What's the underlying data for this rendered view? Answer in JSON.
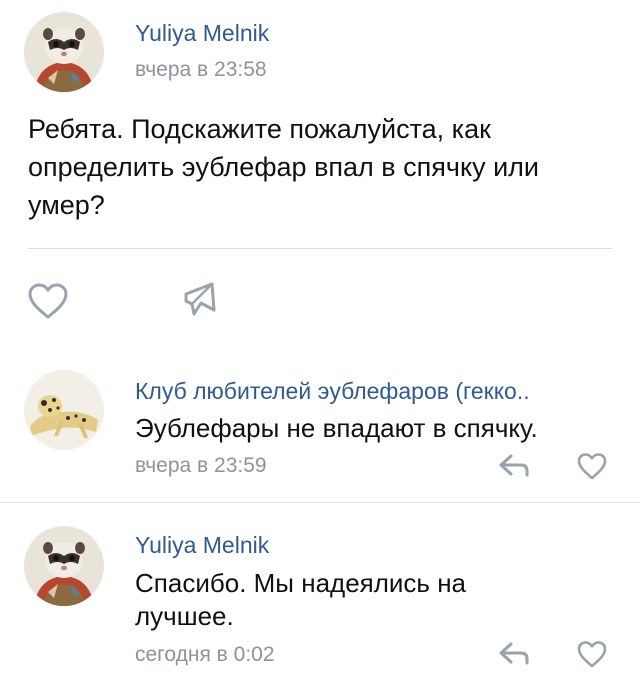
{
  "post": {
    "author": "Yuliya Melnik",
    "time": "вчера в 23:58",
    "text_lines": [
      "Ребята. Подскажите пожалуйста, как",
      "определить эублефар впал в спячку или",
      "умер?"
    ],
    "actions": [
      "heart-icon",
      "share-icon"
    ]
  },
  "comments": [
    {
      "author": "Клуб любителей эублефаров (гекко..",
      "text_lines": [
        "Эублефары не впадают в спячку."
      ],
      "time": "вчера в 23:59",
      "actions": [
        "reply-icon",
        "heart-icon"
      ]
    },
    {
      "author": "Yuliya Melnik",
      "text_lines": [
        "Спасибо. Мы надеялись на",
        "лучшее."
      ],
      "time": "сегодня в 0:02",
      "actions": [
        "reply-icon",
        "heart-icon"
      ]
    }
  ],
  "colors": {
    "author": "#2f5b8f",
    "meta": "#8e939a",
    "icon": "#99a2ad",
    "divider": "#dcdfe3"
  }
}
